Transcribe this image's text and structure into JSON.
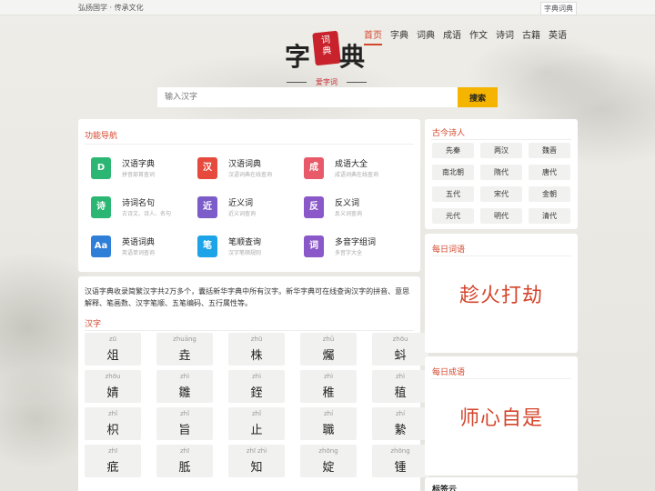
{
  "topbar": {
    "slogan": "弘扬国学 · 传承文化",
    "brand": "字典词典"
  },
  "logo": {
    "char1": "字",
    "char2": "典",
    "seal_line1": "词",
    "seal_line2": "典",
    "sub": "爱字词"
  },
  "nav": [
    "首页",
    "字典",
    "词典",
    "成语",
    "作文",
    "诗词",
    "古籍",
    "英语"
  ],
  "nav_active": "首页",
  "search": {
    "placeholder": "输入汉字",
    "button": "搜索"
  },
  "funcnav": {
    "title": "功能导航",
    "items": [
      {
        "name": "汉语字典",
        "desc": "拼音部首查词",
        "icon": "D",
        "color": "#2bb673"
      },
      {
        "name": "汉语词典",
        "desc": "汉语词典在线查询",
        "icon": "汉",
        "color": "#e64a3c"
      },
      {
        "name": "成语大全",
        "desc": "成语词典在线查询",
        "icon": "成",
        "color": "#e85a6a"
      },
      {
        "name": "诗词名句",
        "desc": "古诗文、诗人、名句",
        "icon": "诗",
        "color": "#2bb673"
      },
      {
        "name": "近义词",
        "desc": "近义词查询",
        "icon": "近",
        "color": "#7b5cc9"
      },
      {
        "name": "反义词",
        "desc": "反义词查询",
        "icon": "反",
        "color": "#8a58c8"
      },
      {
        "name": "英语词典",
        "desc": "英语单词查询",
        "icon": "Aa",
        "color": "#2f7fd8"
      },
      {
        "name": "笔顺查询",
        "desc": "汉字笔顺规则",
        "icon": "笔",
        "color": "#1da4e8"
      },
      {
        "name": "多音字组词",
        "desc": "多音字大全",
        "icon": "词",
        "color": "#8a58c8"
      }
    ]
  },
  "intro": "汉语字典收录简繁汉字共2万多个，囊括新华字典中所有汉字。新华字典可在线查询汉字的拼音、意思解释、笔画数、汉字笔顺、五笔编码、五行属性等。",
  "hanzi_section": {
    "title": "汉字",
    "chars": [
      {
        "py": "zū",
        "ch": "俎"
      },
      {
        "py": "zhuāng",
        "ch": "垚"
      },
      {
        "py": "zhū",
        "ch": "株"
      },
      {
        "py": "zhǔ",
        "ch": "爥"
      },
      {
        "py": "zhōu",
        "ch": "蚪"
      },
      {
        "py": "zhōu",
        "ch": "婧"
      },
      {
        "py": "zhì",
        "ch": "雛"
      },
      {
        "py": "zhì",
        "ch": "銍"
      },
      {
        "py": "zhì",
        "ch": "稚"
      },
      {
        "py": "zhì",
        "ch": "稙"
      },
      {
        "py": "zhǐ",
        "ch": "枳"
      },
      {
        "py": "zhǐ",
        "ch": "旨"
      },
      {
        "py": "zhǐ",
        "ch": "止"
      },
      {
        "py": "zhí",
        "ch": "職"
      },
      {
        "py": "zhí",
        "ch": "縶"
      },
      {
        "py": "zhī",
        "ch": "疷"
      },
      {
        "py": "zhī",
        "ch": "胝"
      },
      {
        "py": "zhī zhì",
        "ch": "知"
      },
      {
        "py": "zhōng",
        "ch": "婝"
      },
      {
        "py": "zhōng",
        "ch": "锺"
      }
    ]
  },
  "poets": {
    "title": "古今诗人",
    "eras": [
      "先秦",
      "两汉",
      "魏晋",
      "南北朝",
      "隋代",
      "唐代",
      "五代",
      "宋代",
      "金朝",
      "元代",
      "明代",
      "清代"
    ]
  },
  "daily_word": {
    "title": "每日词语",
    "word": "趁火打劫"
  },
  "daily_idiom": {
    "title": "每日成语",
    "word": "师心自是"
  },
  "tags": {
    "title": "标签云"
  }
}
